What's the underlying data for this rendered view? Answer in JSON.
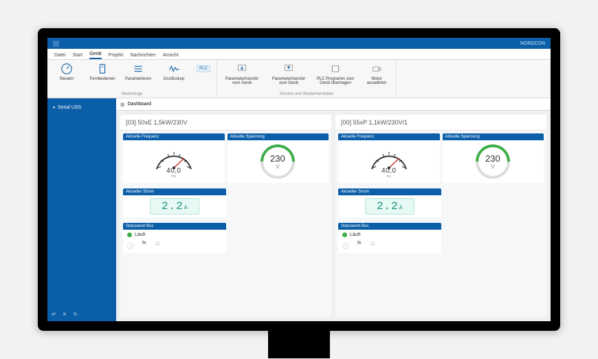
{
  "app": {
    "name": "NORDCON"
  },
  "menu": {
    "tabs": [
      "Datei",
      "Start",
      "Gerät",
      "Projekt",
      "Nachrichten",
      "Ansicht"
    ],
    "active": 2
  },
  "ribbon": {
    "group1_label": "Werkzeuge",
    "group2_label": "Sichern und Wiederherstellen",
    "items": {
      "steuern": "Steuern",
      "fernbedienen": "Fernbedienen",
      "parametrieren": "Parametrieren",
      "oszilloskop": "Oszilloskop",
      "plc": "PLC",
      "pt_from": "Parametertransfer\nvom Gerät",
      "pt_to": "Parametertransfer\nzum Gerät",
      "plc_prog": "PLC Programm zum\nGerät übertragen",
      "motor": "Motor\nauswählen"
    }
  },
  "sidebar": {
    "item1": "Serial USS"
  },
  "tab": {
    "dashboard": "Dashboard"
  },
  "devices": [
    {
      "title": "[03] 50xE 1,5kW/230V",
      "freq_label": "Aktuelle Frequenz",
      "freq_value": "40,0",
      "freq_unit": "Hz",
      "volt_label": "Aktuelle Spannung",
      "volt_value": "230",
      "volt_unit": "V",
      "curr_label": "Aktueller Strom",
      "curr_value": "2.2",
      "curr_unit": "A",
      "status_label": "Statuswort Bus",
      "status_text": "Läuft"
    },
    {
      "title": "[00] 55xP 1,1kW/230V/1",
      "freq_label": "Aktuelle Frequenz",
      "freq_value": "40,0",
      "freq_unit": "Hz",
      "volt_label": "Aktuelle Spannung",
      "volt_value": "230",
      "volt_unit": "V",
      "curr_label": "Aktueller Strom",
      "curr_value": "2.2",
      "curr_unit": "A",
      "status_label": "Statuswort Bus",
      "status_text": "Läuft"
    }
  ]
}
